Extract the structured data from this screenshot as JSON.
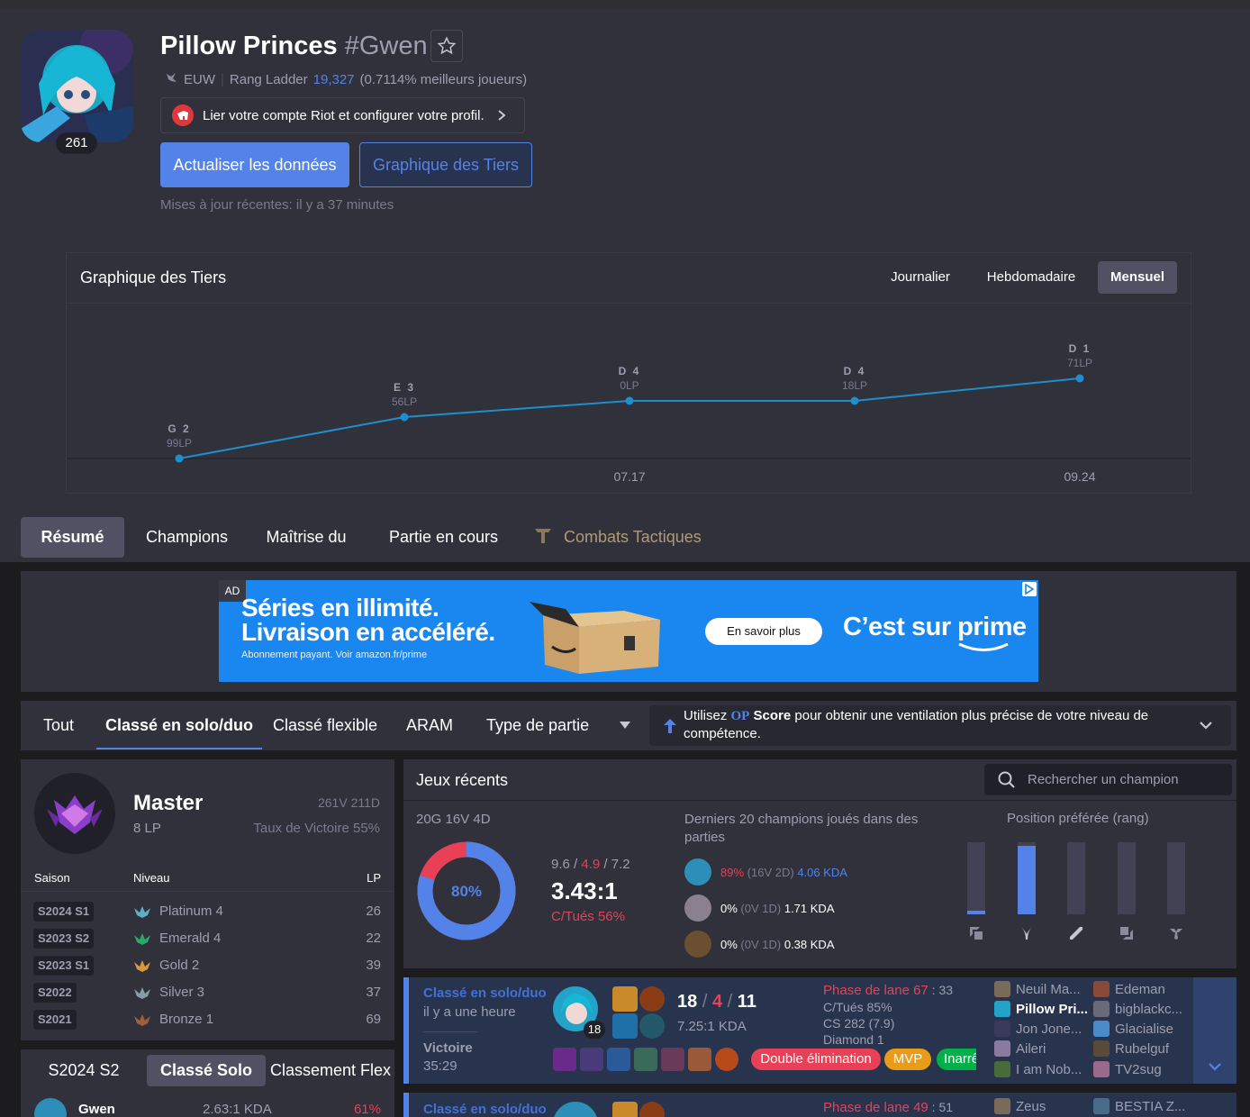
{
  "profile": {
    "name": "Pillow Princes",
    "tag": "#Gwen",
    "level": "261",
    "region": "EUW",
    "ladder_label": "Rang Ladder",
    "ladder_rank": "19,327",
    "ladder_pct": "(0.7114% meilleurs joueurs)",
    "riot_link": "Lier votre compte Riot et configurer votre profil.",
    "update_button": "Actualiser les données",
    "tier_graph_button": "Graphique des Tiers",
    "last_updated": "Mises à jour récentes: il y a 37 minutes"
  },
  "tier_graph": {
    "title": "Graphique des Tiers",
    "periods": [
      "Journalier",
      "Hebdomadaire",
      "Mensuel"
    ],
    "selected_period": "Mensuel"
  },
  "chart_data": {
    "type": "line",
    "points": [
      {
        "tier": "G 2",
        "lp": "99LP"
      },
      {
        "tier": "E 3",
        "lp": "56LP"
      },
      {
        "tier": "D 4",
        "lp": "0LP"
      },
      {
        "tier": "D 4",
        "lp": "18LP"
      },
      {
        "tier": "D 1",
        "lp": "71LP"
      }
    ],
    "x_labels": [
      "07.17",
      "09.24"
    ],
    "color": "#1f8ecd"
  },
  "tabs": [
    "Résumé",
    "Champions",
    "Maîtrise du",
    "Partie en cours",
    "Combats Tactiques"
  ],
  "ad": {
    "label": "AD",
    "line1": "Séries en illimité.",
    "line2": "Livraison en accéléré.",
    "small": "Abonnement payant. Voir amazon.fr/prime",
    "cta": "En savoir plus",
    "brand": "C’est sur prime"
  },
  "filters": {
    "tabs": [
      "Tout",
      "Classé en solo/duo",
      "Classé flexible",
      "ARAM",
      "Type de partie"
    ],
    "selected": "Classé en solo/duo",
    "op_pre": "Utilisez ",
    "op_brand": "OP",
    "op_score": " Score",
    "op_post": " pour obtenir une ventilation plus précise de votre niveau de compétence."
  },
  "rank": {
    "tier": "Master",
    "lp": "8 LP",
    "wl": "261V 211D",
    "winrate": "Taux de Victoire 55%",
    "headers": [
      "Saison",
      "Niveau",
      "LP"
    ],
    "seasons": [
      {
        "season": "S2024 S1",
        "tier": "Platinum 4",
        "lp": "26",
        "color": "#5ab0c8"
      },
      {
        "season": "S2023 S2",
        "tier": "Emerald 4",
        "lp": "22",
        "color": "#2aa866"
      },
      {
        "season": "S2023 S1",
        "tier": "Gold 2",
        "lp": "39",
        "color": "#d49a3c"
      },
      {
        "season": "S2022",
        "tier": "Silver 3",
        "lp": "37",
        "color": "#8a9ba8"
      },
      {
        "season": "S2021",
        "tier": "Bronze 1",
        "lp": "69",
        "color": "#a0603c"
      }
    ]
  },
  "champ_tabs": {
    "tabs": [
      "S2024 S2",
      "Classé Solo",
      "Classement Flex"
    ],
    "first_name": "Gwen",
    "first_kda": "2.63:1 KDA",
    "first_wr": "61%"
  },
  "recent": {
    "title": "Jeux récents",
    "search_placeholder": "Rechercher un champion",
    "summary": "20G 16V 4D",
    "winrate": "80%",
    "kda_k": "9.6",
    "kda_d": "4.9",
    "kda_a": "7.2",
    "kda_ratio": "3.43:1",
    "kill_participation": "C/Tués 56%",
    "last20_title": "Derniers 20 champions joués dans des parties",
    "champions": [
      {
        "wr": "89%",
        "record": "(16V 2D)",
        "kda": "4.06 KDA",
        "wr_color": "#e84057",
        "kda_color": "#5383e8"
      },
      {
        "wr": "0%",
        "record": "(0V 1D)",
        "kda": "1.71 KDA",
        "wr_color": "#9e9eb1",
        "kda_color": "#9e9eb1"
      },
      {
        "wr": "0%",
        "record": "(0V 1D)",
        "kda": "0.38 KDA",
        "wr_color": "#9e9eb1",
        "kda_color": "#9e9eb1"
      }
    ],
    "position_title": "Position préférée (rang)",
    "positions": [
      {
        "name": "top",
        "share": 0.05
      },
      {
        "name": "jungle",
        "share": 0.95
      },
      {
        "name": "mid",
        "share": 0
      },
      {
        "name": "adc",
        "share": 0
      },
      {
        "name": "support",
        "share": 0
      }
    ]
  },
  "games": [
    {
      "queue": "Classé en solo/duo",
      "time": "il y a une heure",
      "result": "Victoire",
      "duration": "35:29",
      "champ_level": "18",
      "kills": "18",
      "deaths": "4",
      "assists": "11",
      "kda": "7.25:1 KDA",
      "lane_phase_label": "Phase de lane 67",
      "lane_phase_score": "33",
      "kp": "C/Tués 85%",
      "cs": "CS 282 (7.9)",
      "rank": "Diamond 1",
      "badges": [
        "Double élimination",
        "MVP",
        "Inarrêtable"
      ],
      "team1": [
        "Neuil Ma...",
        "Pillow Pri...",
        "Jon Jone...",
        "Aileri",
        "I am Nob..."
      ],
      "team2": [
        "Edeman",
        "bigblackc...",
        "Glacialise",
        "Rubelguf",
        "TV2sug"
      ]
    },
    {
      "queue": "Classé en solo/duo",
      "lane_phase_label": "Phase de lane 49",
      "lane_phase_score": "51",
      "team1_first": "Zeus",
      "team2_first": "BESTIA Z..."
    }
  ]
}
